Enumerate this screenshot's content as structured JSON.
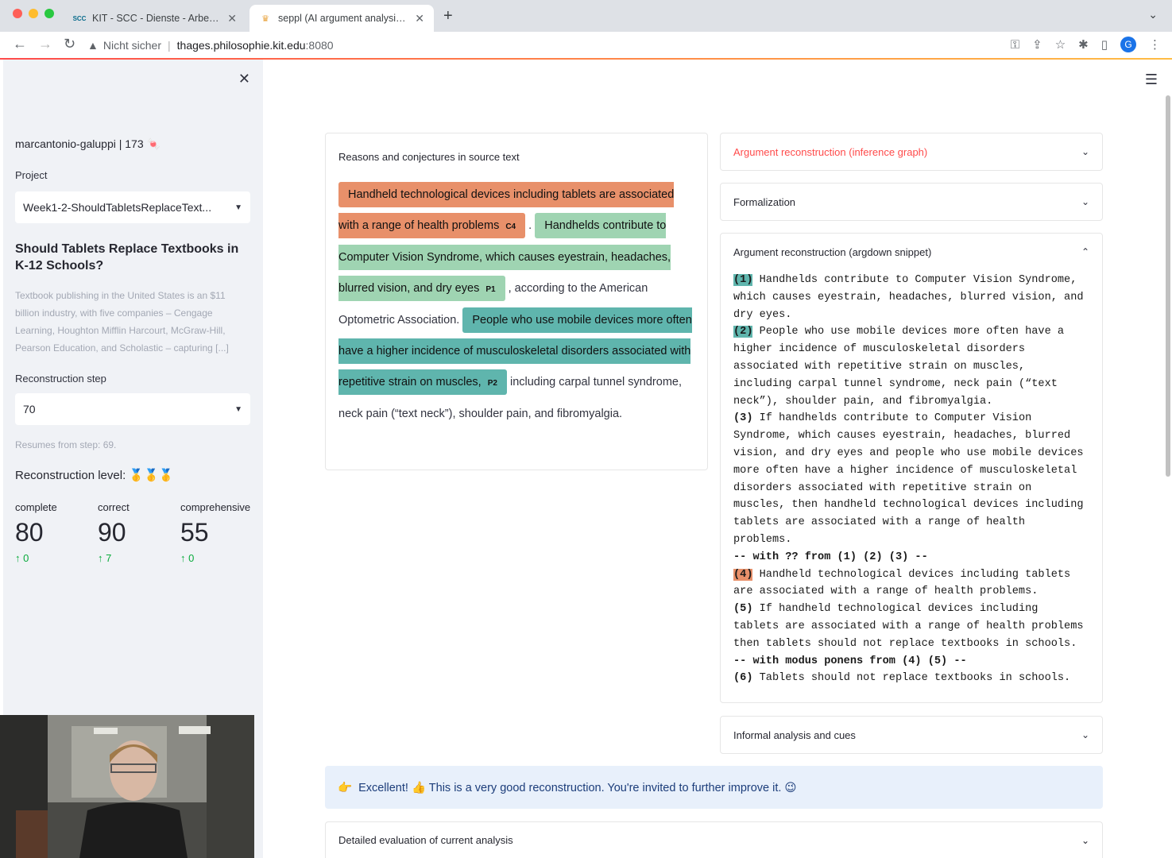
{
  "browser": {
    "tabs": [
      {
        "favicon": "SCC",
        "title": "KIT - SCC - Dienste - Arbeitsum"
      },
      {
        "favicon": "crown-favicon",
        "title": "seppl (AI argument analysis tut"
      }
    ],
    "url_warning": "Nicht sicher",
    "url_host": "thages.philosophie.kit.edu",
    "url_port": ":8080",
    "avatar_letter": "G"
  },
  "sidebar": {
    "user": "marcantonio-galuppi | 173 🍬",
    "project_label": "Project",
    "project_value": "Week1-2-ShouldTabletsReplaceText...",
    "title": "Should Tablets Replace Textbooks in K-12 Schools?",
    "description": "Textbook publishing in the United States is an $11 billion industry, with five companies – Cengage Learning, Houghton Mifflin Harcourt, McGraw-Hill, Pearson Education, and Scholastic – capturing [...]",
    "step_label": "Reconstruction step",
    "step_value": "70",
    "resume_text": "Resumes from step: 69.",
    "level_text": "Reconstruction level: 🥇🥇🥇",
    "metrics": [
      {
        "label": "complete",
        "value": "80",
        "delta": "↑ 0"
      },
      {
        "label": "correct",
        "value": "90",
        "delta": "↑ 7"
      },
      {
        "label": "comprehensive",
        "value": "55",
        "delta": "↑ 0"
      }
    ]
  },
  "source": {
    "heading": "Reasons and conjectures in source text",
    "c4_text": "Handheld technological devices including tablets are associated with a range of health problems",
    "c4_tag": "C4",
    "after_c4": " .",
    "p1_text": "Handhelds contribute to Computer Vision Syndrome, which causes eyestrain, headaches, blurred vision, and dry eyes",
    "p1_tag": "P1",
    "after_p1": " , according to the American Optometric Association. ",
    "p2_text": "People who use mobile devices more often have a higher incidence of musculoskeletal disorders associated with repetitive strain on muscles,",
    "p2_tag": "P2",
    "after_p2": " including carpal tunnel syndrome, neck pain (“text neck”), shoulder pain, and fibromyalgia."
  },
  "panels": {
    "inference_graph": "Argument reconstruction (inference graph)",
    "formalization": "Formalization",
    "argdown": "Argument reconstruction (argdown snippet)",
    "informal": "Informal analysis and cues",
    "evaluation": "Detailed evaluation of current analysis"
  },
  "argdown": {
    "l1_num": "(1)",
    "l1_text": " Handhelds contribute to Computer Vision Syndrome, which causes eyestrain, headaches, blurred vision, and dry eyes.",
    "l2_num": "(2)",
    "l2_text": " People who use mobile devices more often have a higher incidence of musculoskeletal disorders associated with repetitive strain on muscles, including carpal tunnel syndrome, neck pain (“text neck”), shoulder pain, and fibromyalgia.",
    "l3_num": "(3)",
    "l3_text": " If handhelds contribute to Computer Vision Syndrome, which causes eyestrain, headaches, blurred vision, and dry eyes and people who use mobile devices more often have a higher incidence of musculoskeletal disorders associated with repetitive strain on muscles, then handheld technological devices including tablets are associated with a range of health problems.",
    "inf1": "-- with ?? from (1) (2) (3) --",
    "l4_num": "(4)",
    "l4_text": " Handheld technological devices including tablets are associated with a range of health problems.",
    "l5_num": "(5)",
    "l5_text": " If handheld technological devices including tablets are associated with a range of health problems then tablets should not replace textbooks in schools.",
    "inf2": "-- with modus ponens from (4) (5) --",
    "l6_num": "(6)",
    "l6_text": " Tablets should not replace textbooks in schools."
  },
  "alert": {
    "emoji": "👉",
    "text": "Excellent! 👍 This is a very good reconstruction. You're invited to further improve it. 😉"
  },
  "colors": {
    "conclusion": "#e8906a",
    "premise1": "#9fd4b2",
    "premise2": "#5fb5ad",
    "accent": "#ff4b4b"
  }
}
